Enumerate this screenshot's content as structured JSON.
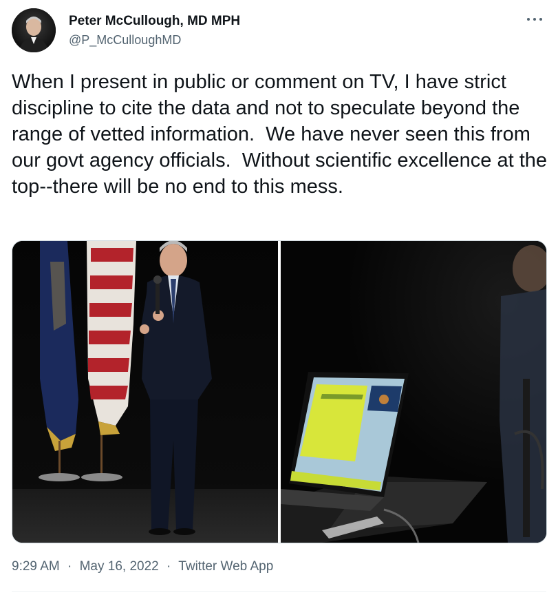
{
  "tweet": {
    "author_name": "Peter McCullough, MD MPH",
    "author_handle": "@P_McCulloughMD",
    "text": "When I present in public or comment on TV, I have strict discipline to cite the data and not to speculate beyond the range of vetted information.  We have never seen this from our govt agency officials.  Without scientific excellence at the top--there will be no end to this mess.",
    "time": "9:29 AM",
    "separator": "·",
    "date": "May 16, 2022",
    "source": "Twitter Web App"
  },
  "icons": {
    "more": "more-options-icon"
  },
  "colors": {
    "text_primary": "#0f1419",
    "text_secondary": "#536471",
    "border": "#cfd9de"
  }
}
